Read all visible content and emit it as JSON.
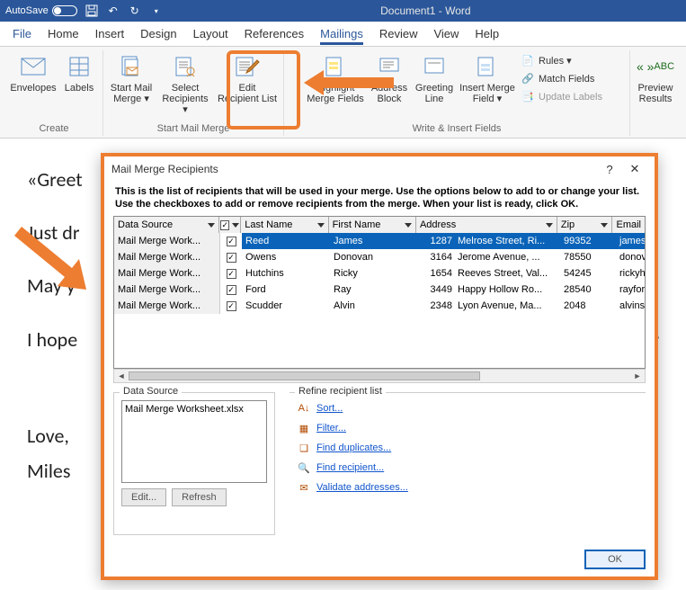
{
  "titlebar": {
    "autosave": "AutoSave",
    "doc": "Document1  -  Word"
  },
  "menu": {
    "file": "File",
    "home": "Home",
    "insert": "Insert",
    "design": "Design",
    "layout": "Layout",
    "references": "References",
    "mailings": "Mailings",
    "review": "Review",
    "view": "View",
    "help": "Help"
  },
  "ribbon": {
    "create": {
      "envelopes": "Envelopes",
      "labels": "Labels",
      "group": "Create"
    },
    "smm": {
      "start": "Start Mail\nMerge ▾",
      "select": "Select\nRecipients ▾",
      "edit": "Edit\nRecipient List",
      "group": "Start Mail Merge"
    },
    "wif": {
      "highlight": "Highlight\nMerge Fields",
      "address": "Address\nBlock",
      "greeting": "Greeting\nLine",
      "imf": "Insert Merge\nField ▾",
      "rules": "Rules ▾",
      "match": "Match Fields",
      "update": "Update Labels",
      "group": "Write & Insert Fields"
    },
    "preview": {
      "label": "Preview\nResults"
    }
  },
  "document": {
    "p1": "«Greet",
    "p2": "Just dr",
    "p3": "May y",
    "p4": "I hope",
    "p4_tail": "tir",
    "p5": "Love,",
    "p6": "Miles "
  },
  "dialog": {
    "title": "Mail Merge Recipients",
    "desc": "This is the list of recipients that will be used in your merge.  Use the options below to add to or change your list.  Use the checkboxes to add or remove recipients from the merge.  When your list is ready, click OK.",
    "cols": {
      "ds": "Data Source",
      "ln": "Last Name",
      "fn": "First Name",
      "addr": "Address",
      "zip": "Zip",
      "email": "Email"
    },
    "rows": [
      {
        "ds": "Mail Merge Work...",
        "ln": "Reed",
        "fn": "James",
        "num": "1287",
        "addr": "Melrose Street, Ri...",
        "zip": "99352",
        "email": "jamesre"
      },
      {
        "ds": "Mail Merge Work...",
        "ln": "Owens",
        "fn": "Donovan",
        "num": "3164",
        "addr": "Jerome Avenue, ...",
        "zip": "78550",
        "email": "donovar"
      },
      {
        "ds": "Mail Merge Work...",
        "ln": "Hutchins",
        "fn": "Ricky",
        "num": "1654",
        "addr": "Reeves Street, Val...",
        "zip": "54245",
        "email": "rickyhut"
      },
      {
        "ds": "Mail Merge Work...",
        "ln": "Ford",
        "fn": "Ray",
        "num": "3449",
        "addr": "Happy Hollow Ro...",
        "zip": "28540",
        "email": "rayford("
      },
      {
        "ds": "Mail Merge Work...",
        "ln": "Scudder",
        "fn": "Alvin",
        "num": "2348",
        "addr": "Lyon Avenue, Ma...",
        "zip": "2048",
        "email": "alvinscu"
      }
    ],
    "ds_legend": "Data Source",
    "ds_file": "Mail Merge Worksheet.xlsx",
    "edit_btn": "Edit...",
    "refresh_btn": "Refresh",
    "refine_legend": "Refine recipient list",
    "refine": {
      "sort": "Sort...",
      "filter": "Filter...",
      "dup": "Find duplicates...",
      "find": "Find recipient...",
      "val": "Validate addresses..."
    },
    "ok": "OK"
  }
}
